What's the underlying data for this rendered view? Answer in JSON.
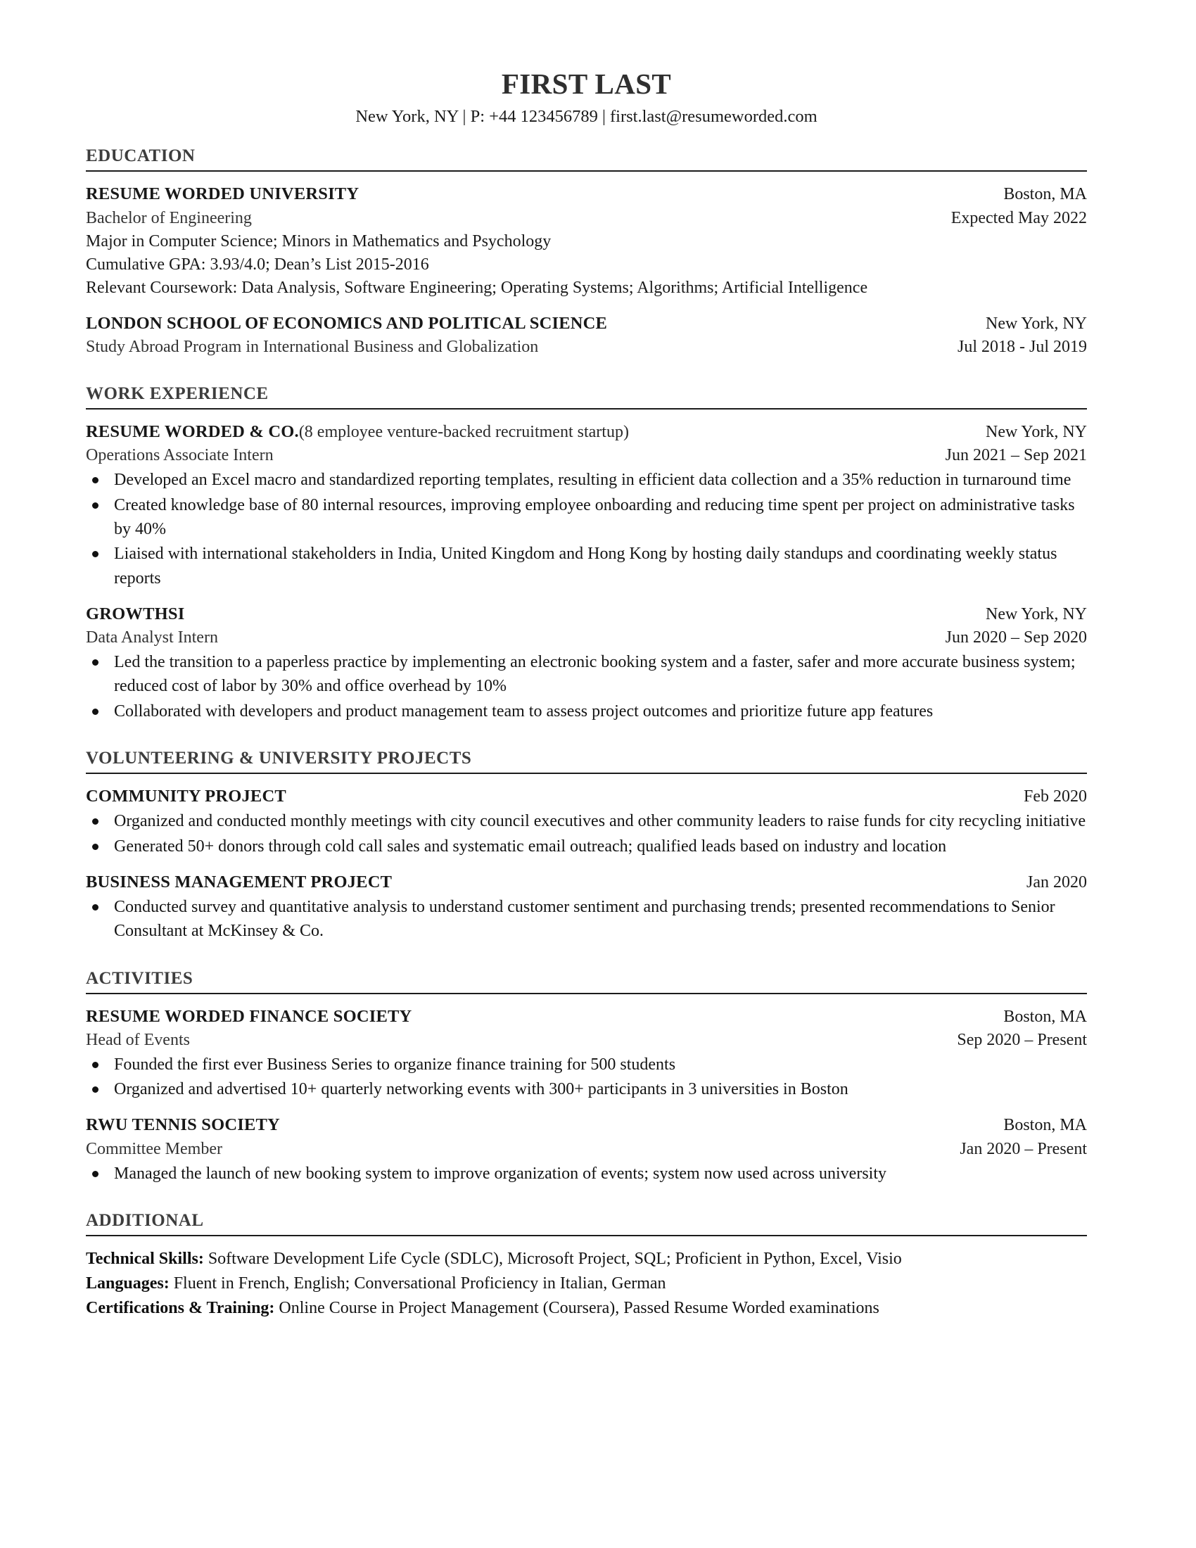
{
  "header": {
    "name": "FIRST LAST",
    "contact": "New York, NY | P: +44 123456789 | first.last@resumeworded.com"
  },
  "sections": {
    "education": {
      "title": "EDUCATION",
      "entries": [
        {
          "org": "RESUME WORDED UNIVERSITY",
          "location": "Boston, MA",
          "role": "Bachelor of Engineering",
          "dates": "Expected May 2022",
          "details": [
            "Major in Computer Science; Minors in Mathematics and Psychology",
            "Cumulative GPA: 3.93/4.0; Dean’s List 2015-2016",
            "Relevant Coursework: Data Analysis, Software Engineering; Operating Systems; Algorithms; Artificial Intelligence"
          ]
        },
        {
          "org": "LONDON SCHOOL OF ECONOMICS AND POLITICAL SCIENCE",
          "location": "New York, NY",
          "role": "Study Abroad Program in International Business and Globalization",
          "dates": "Jul 2018 - Jul 2019",
          "details": []
        }
      ]
    },
    "work_experience": {
      "title": "WORK EXPERIENCE",
      "entries": [
        {
          "org": "RESUME WORDED & CO.",
          "org_note": "(8 employee venture-backed recruitment startup)",
          "location": "New York, NY",
          "role": "Operations Associate Intern",
          "dates": "Jun 2021 – Sep 2021",
          "bullets": [
            "Developed an Excel macro and standardized reporting templates, resulting in efficient data collection and a 35% reduction in turnaround time",
            "Created knowledge base of 80 internal resources, improving employee onboarding and reducing time spent per project on administrative tasks by 40%",
            "Liaised with international stakeholders in India, United Kingdom and Hong Kong by hosting daily standups and coordinating weekly status reports"
          ]
        },
        {
          "org": "GROWTHSI",
          "org_note": "",
          "location": "New York, NY",
          "role": "Data Analyst Intern",
          "dates": "Jun 2020 – Sep 2020",
          "bullets": [
            "Led the transition to a paperless practice by implementing an electronic booking system and a faster, safer and more accurate business system; reduced cost of labor by 30% and office overhead by 10%",
            "Collaborated with developers and product management team to assess project outcomes and prioritize future app features"
          ]
        }
      ]
    },
    "volunteering": {
      "title": "VOLUNTEERING & UNIVERSITY PROJECTS",
      "entries": [
        {
          "org": "COMMUNITY PROJECT",
          "dates": "Feb 2020",
          "bullets": [
            "Organized and conducted monthly meetings with city council executives and other community leaders to raise funds for city recycling initiative",
            "Generated 50+ donors through cold call sales and systematic email outreach; qualified leads based on industry and location"
          ]
        },
        {
          "org": "BUSINESS MANAGEMENT PROJECT",
          "dates": "Jan 2020",
          "bullets": [
            "Conducted survey and quantitative analysis to understand customer sentiment and purchasing trends; presented recommendations to Senior Consultant at McKinsey & Co."
          ]
        }
      ]
    },
    "activities": {
      "title": "ACTIVITIES",
      "entries": [
        {
          "org": "RESUME WORDED FINANCE SOCIETY",
          "location": "Boston, MA",
          "role": "Head of Events",
          "dates": "Sep 2020 – Present",
          "bullets": [
            "Founded the first ever Business Series to organize finance training for 500 students",
            "Organized and advertised 10+ quarterly networking events with 300+ participants in 3 universities in Boston"
          ]
        },
        {
          "org": "RWU TENNIS SOCIETY",
          "location": "Boston, MA",
          "role": "Committee Member",
          "dates": "Jan 2020 – Present",
          "bullets": [
            "Managed the launch of new booking system to improve organization of events; system now used across university"
          ]
        }
      ]
    },
    "additional": {
      "title": "ADDITIONAL",
      "lines": [
        {
          "label": "Technical Skills:",
          "value": " Software Development Life Cycle (SDLC), Microsoft Project, SQL; Proficient in Python, Excel, Visio"
        },
        {
          "label": "Languages:",
          "value": " Fluent in French, English; Conversational Proficiency in Italian, German"
        },
        {
          "label": "Certifications & Training:",
          "value": " Online Course in Project Management (Coursera), Passed Resume Worded examinations"
        }
      ]
    }
  }
}
